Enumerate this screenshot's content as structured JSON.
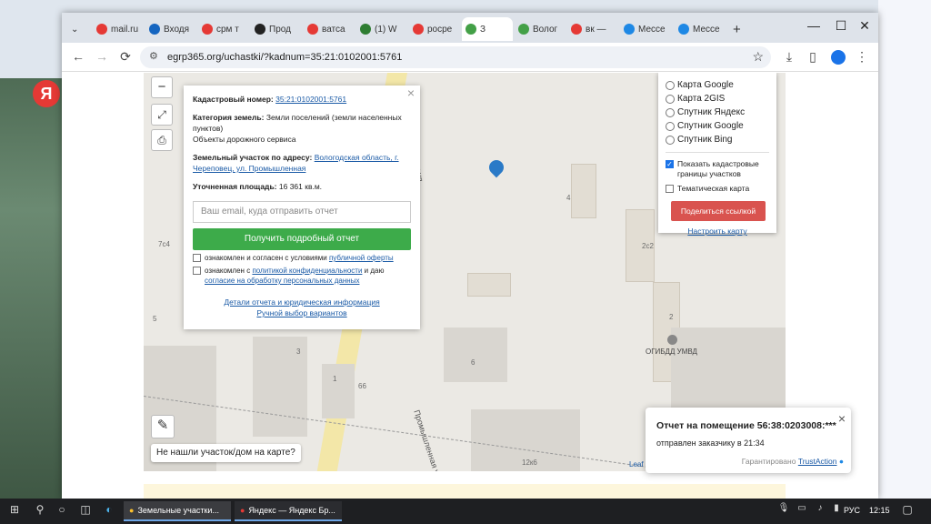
{
  "browser": {
    "tabs": [
      {
        "label": "mail.ru",
        "color": "#e53935"
      },
      {
        "label": "Входя",
        "color": "#1565c0"
      },
      {
        "label": "срм т",
        "color": "#e53935"
      },
      {
        "label": "Прод",
        "color": "#222222"
      },
      {
        "label": "ватса",
        "color": "#e53935"
      },
      {
        "label": "(1) W",
        "color": "#2e7d32"
      },
      {
        "label": "росре",
        "color": "#e53935"
      },
      {
        "label": "З",
        "color": "#43a047"
      },
      {
        "label": "Волог",
        "color": "#43a047"
      },
      {
        "label": "вк — ",
        "color": "#e53935"
      },
      {
        "label": "Мессе",
        "color": "#1e88e5"
      },
      {
        "label": "Мессе",
        "color": "#1e88e5"
      }
    ],
    "active_tab_index": 7,
    "new_tab_label": "+",
    "url": "egrp365.org/uchastki/?kadnum=35:21:0102001:5761",
    "back_icon": "←",
    "forward_icon": "→",
    "reload_icon": "⟳",
    "star_icon": "☆",
    "download_icon": "⤓",
    "menu_icon": "⋮",
    "minimize": "—",
    "maximize": "☐",
    "close": "✕"
  },
  "popup": {
    "cadastral_label": "Кадастровый номер:",
    "cadastral_value": "35:21:0102001:5761",
    "category_label": "Категория земель:",
    "category_value": "Земли поселений (земли населенных пунктов)",
    "category_extra": "Объекты дорожного сервиса",
    "address_label": "Земельный участок по адресу:",
    "address_value": "Вологодская область, г. Череповец, ул. Промышленная",
    "area_label": "Уточненная площадь:",
    "area_value": "16 361 кв.м.",
    "email_placeholder": "Ваш email, куда отправить отчет",
    "submit_label": "Получить подробный отчет",
    "check1_prefix": "ознакомлен и согласен с условиями",
    "check1_link": "публичной оферты",
    "check2_prefix": "ознакомлен с",
    "check2_link1": "политикой конфиденциальности",
    "check2_mid": "и даю",
    "check2_link2": "согласие на обработку персональных данных",
    "details_link": "Детали отчета и юридическая информация",
    "manual_link": "Ручной выбор вариантов",
    "close_icon": "×"
  },
  "layers": {
    "options": [
      "Карта Google",
      "Карта 2GIS",
      "Спутник Яндекс",
      "Спутник Google",
      "Спутник Bing"
    ],
    "show_borders_label": "Показать кадастровые границы участков",
    "show_borders_checked": true,
    "thematic_label": "Тематическая карта",
    "thematic_checked": false,
    "share_label": "Поделиться ссылкой",
    "customize_link": "Настроить карту"
  },
  "map": {
    "zoom_out": "−",
    "not_found_label": "Не нашли участок/дом на карте?",
    "street_label": "Промышленная ул.",
    "street_label_2": "ная ул.",
    "poi_label": "ОГИБДД УМВД",
    "leaflet_label": "Leaf",
    "numbers": [
      "4",
      "2с2",
      "2",
      "6",
      "3",
      "1",
      "66",
      "5",
      "7с4",
      "12к6"
    ]
  },
  "notification": {
    "title": "Отчет на помещение 56:38:0203008:***",
    "subtitle": "отправлен заказчику в 21:34",
    "guarantee": "Гарантировано",
    "brand": "TrustAction",
    "close_icon": "×"
  },
  "taskbar": {
    "task1": "Земельные участки...",
    "task2": "Яндекс — Яндекс Бр...",
    "lang": "РУС",
    "time": "12:15"
  }
}
